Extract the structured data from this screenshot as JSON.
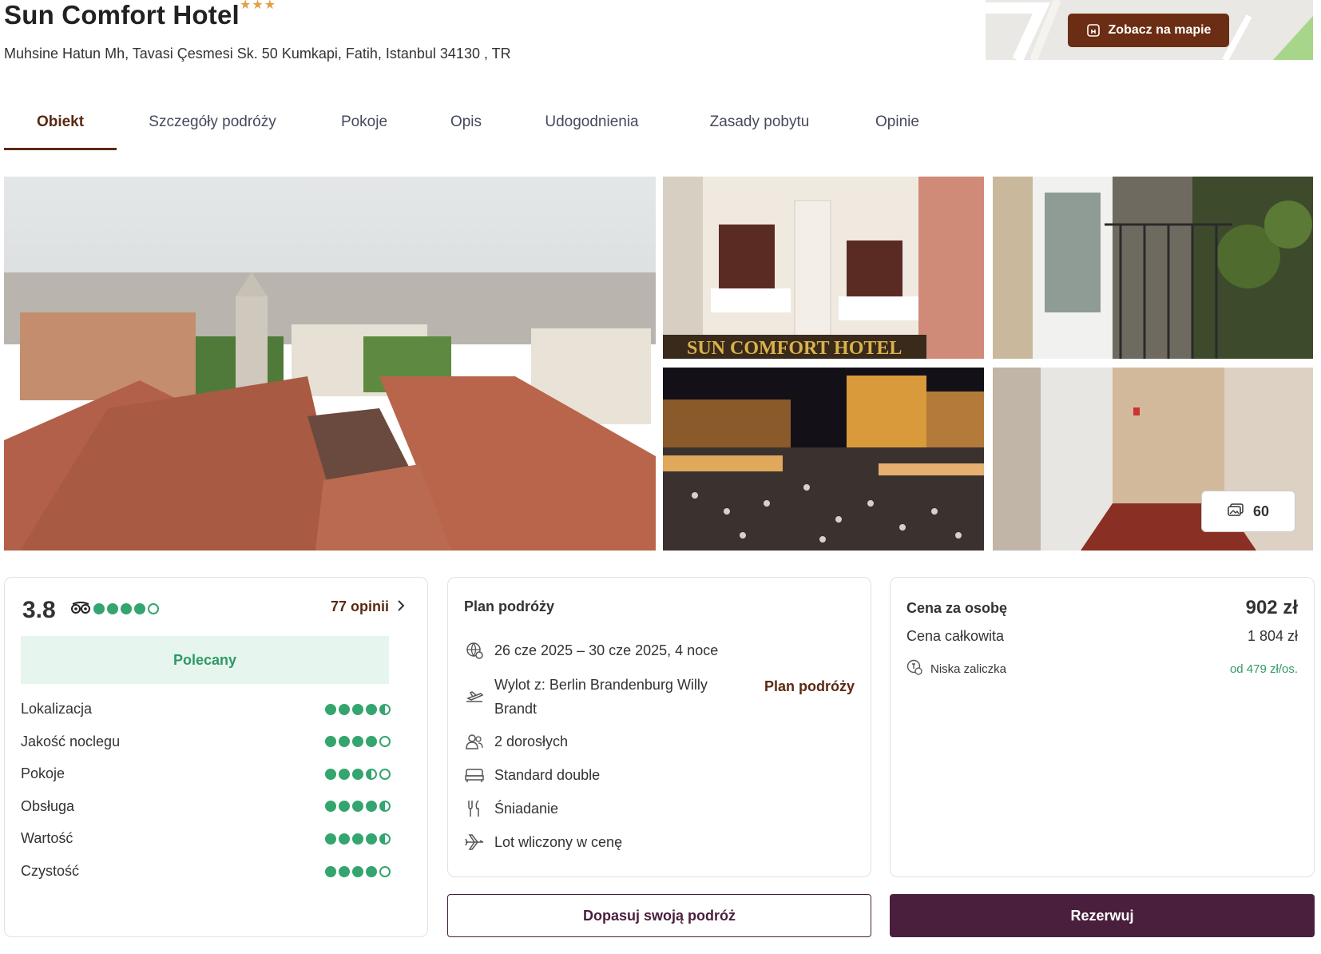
{
  "header": {
    "title": "Sun Comfort Hotel",
    "stars": "★★★",
    "star_rating": 3,
    "address": "Muhsine Hatun Mh, Tavasi Çesmesi Sk. 50 Kumkapi, Fatih, Istanbul 34130 , TR",
    "map_button_label": "Zobacz na mapie",
    "map_icon": "hotel-building-icon"
  },
  "tabs": [
    {
      "label": "Obiekt",
      "active": true
    },
    {
      "label": "Szczegóły podróży",
      "active": false
    },
    {
      "label": "Pokoje",
      "active": false
    },
    {
      "label": "Opis",
      "active": false
    },
    {
      "label": "Udogodnienia",
      "active": false
    },
    {
      "label": "Zasady pobytu",
      "active": false
    },
    {
      "label": "Opinie",
      "active": false
    }
  ],
  "gallery": {
    "photos": [
      "rooftops-view-photo",
      "hotel-facade-photo",
      "balcony-door-photo",
      "night-street-photo",
      "hallway-photo"
    ],
    "photo_count": "60",
    "count_icon": "images-icon"
  },
  "rating": {
    "score": "3.8",
    "bubbles": 4,
    "source_icon": "tripadvisor-icon",
    "reviews_link": "77 opinii",
    "badge": "Polecany",
    "criteria": [
      {
        "label": "Lokalizacja",
        "score": 4.5
      },
      {
        "label": "Jakość noclegu",
        "score": 4.0
      },
      {
        "label": "Pokoje",
        "score": 3.5
      },
      {
        "label": "Obsługa",
        "score": 4.5
      },
      {
        "label": "Wartość",
        "score": 4.5
      },
      {
        "label": "Czystość",
        "score": 4.0
      }
    ],
    "accent_color": "#34a56f"
  },
  "plan": {
    "title": "Plan podróży",
    "dates": "26 cze 2025 – 30 cze 2025, 4 noce",
    "departure_line1": "Wylot z: Berlin Brandenburg Willy",
    "departure_line2": "Brandt",
    "guests": "2 dorosłych",
    "room": "Standard double",
    "board": "Śniadanie",
    "flight": "Lot wliczony w cenę",
    "link": "Plan podróży"
  },
  "price": {
    "per_person_label": "Cena za osobę",
    "per_person_value": "902 zł",
    "total_label": "Cena całkowita",
    "total_value": "1 804 zł",
    "deposit_label": "Niska zaliczka",
    "deposit_value": "od 479 zł/os.",
    "deposit_color": "#2f9a64"
  },
  "actions": {
    "customize": "Dopasuj swoją podróż",
    "book": "Rezerwuj",
    "brand_color": "#4a1f3e"
  }
}
